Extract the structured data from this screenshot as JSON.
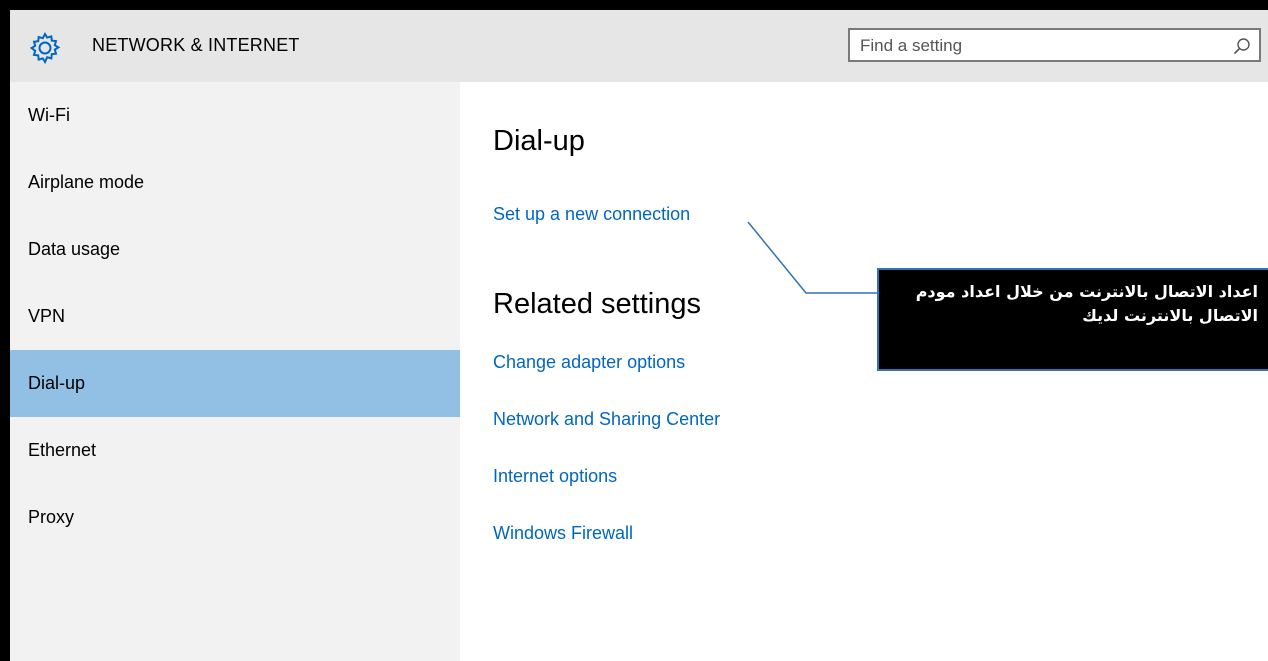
{
  "header": {
    "title": "NETWORK & INTERNET",
    "icon": "gear-icon",
    "search": {
      "placeholder": "Find a setting",
      "value": "",
      "icon": "search-icon"
    }
  },
  "sidebar": {
    "items": [
      {
        "label": "Wi-Fi",
        "active": false
      },
      {
        "label": "Airplane mode",
        "active": false
      },
      {
        "label": "Data usage",
        "active": false
      },
      {
        "label": "VPN",
        "active": false
      },
      {
        "label": "Dial-up",
        "active": true
      },
      {
        "label": "Ethernet",
        "active": false
      },
      {
        "label": "Proxy",
        "active": false
      }
    ]
  },
  "main": {
    "title": "Dial-up",
    "setup_link": "Set up a new connection",
    "related_heading": "Related settings",
    "related_links": [
      "Change adapter options",
      "Network and Sharing Center",
      "Internet options",
      "Windows Firewall"
    ]
  },
  "annotation": {
    "text": "اعداد الاتصال بالانترنت من خلال اعداد مودم الاتصال بالانترنت لديك"
  },
  "colors": {
    "accent_link": "#0067c0",
    "selected_item": "#92c0e4",
    "titlebar": "#e6e6e6",
    "sidebar": "#f2f2f2",
    "callout_border": "#2e74b5"
  }
}
